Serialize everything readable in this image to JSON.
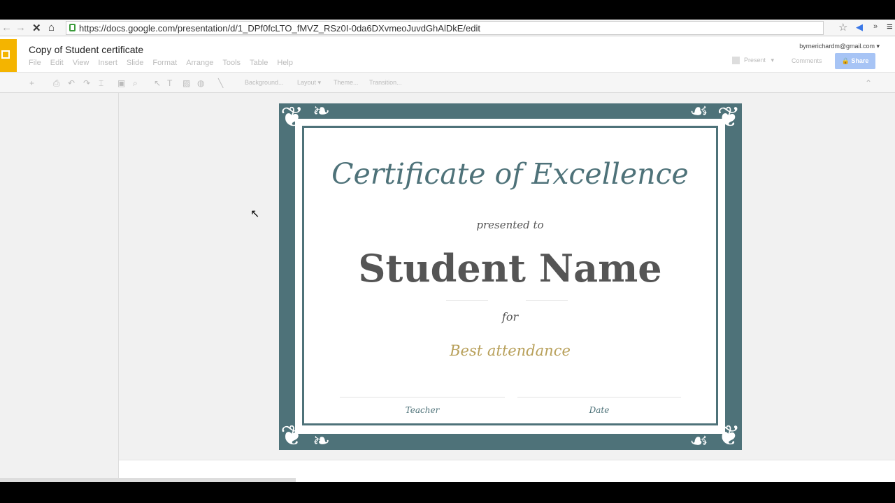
{
  "browser": {
    "url": "https://docs.google.com/presentation/d/1_DPf0fcLTO_fMVZ_RSz0I-0da6DXvmeoJuvdGhAlDkE/edit"
  },
  "app": {
    "title": "Copy of Student certificate",
    "menu": [
      "File",
      "Edit",
      "View",
      "Insert",
      "Slide",
      "Format",
      "Arrange",
      "Tools",
      "Table",
      "Help"
    ],
    "account": "byrnerichardm@gmail.com",
    "present": "Present",
    "comments": "Comments",
    "share": "Share",
    "accent": "#f4b400"
  },
  "toolbar": {
    "background": "Background...",
    "layout": "Layout",
    "theme": "Theme...",
    "transition": "Transition..."
  },
  "slide": {
    "title": "Certificate of Excellence",
    "presented": "presented to",
    "name": "Student Name",
    "for": "for",
    "reason": "Best attendance",
    "teacher": "Teacher",
    "date": "Date",
    "colors": {
      "frame": "#4e7279",
      "gold": "#b8a05a"
    }
  }
}
